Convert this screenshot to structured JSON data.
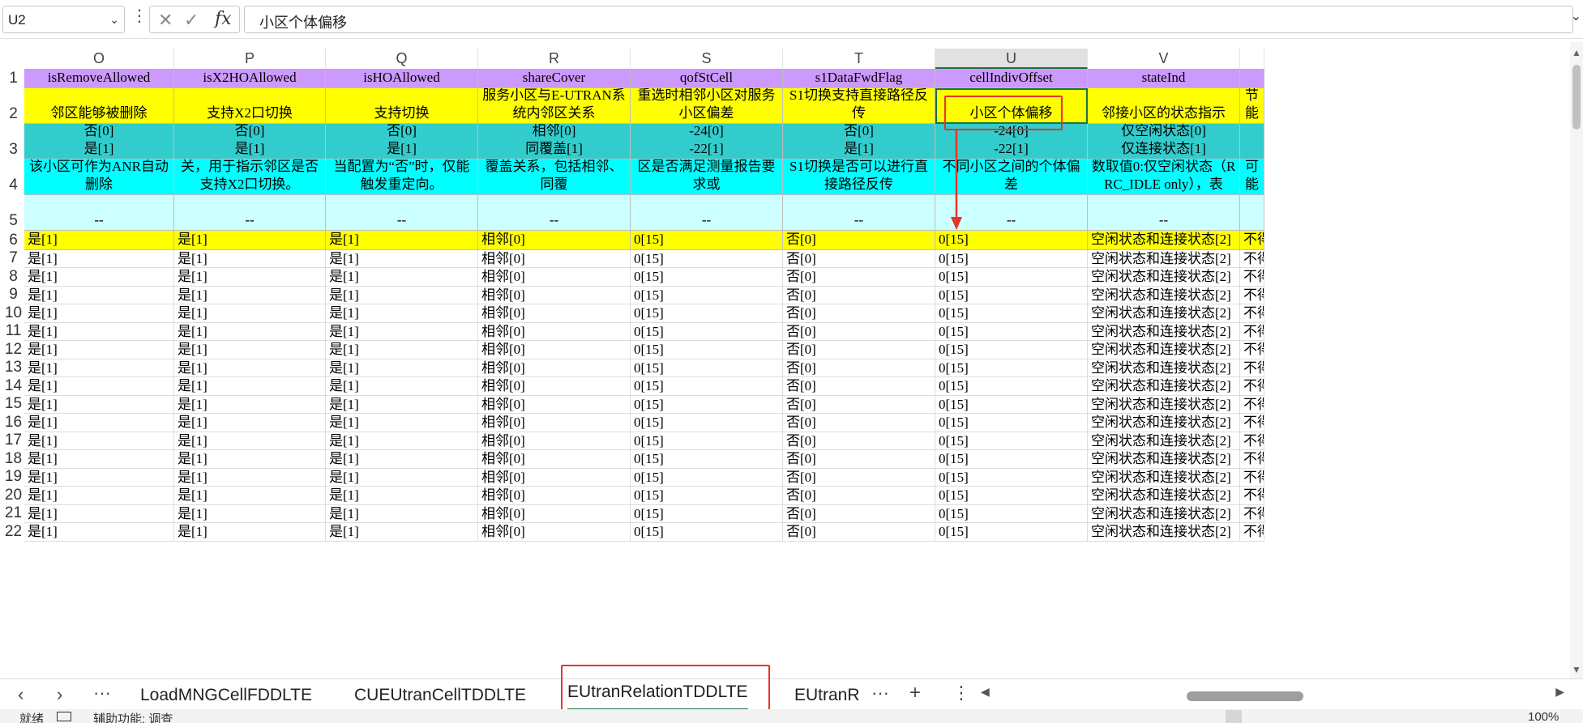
{
  "formula_bar": {
    "name_box": "U2",
    "formula": "小区个体偏移"
  },
  "columns": [
    "O",
    "P",
    "Q",
    "R",
    "S",
    "T",
    "U",
    "V"
  ],
  "selected_column": "U",
  "row_numbers": [
    "1",
    "2",
    "3",
    "4",
    "5",
    "6",
    "7",
    "8",
    "9",
    "10",
    "11",
    "12",
    "13",
    "14",
    "15",
    "16",
    "17",
    "18",
    "19",
    "20",
    "21",
    "22"
  ],
  "header_rows": {
    "r1": [
      "isRemoveAllowed",
      "isX2HOAllowed",
      "isHOAllowed",
      "shareCover",
      "qofStCell",
      "s1DataFwdFlag",
      "cellIndivOffset",
      "stateInd"
    ],
    "r2": [
      "邻区能够被删除",
      "支持X2口切换",
      "支持切换",
      "服务小区与E-UTRAN系统内邻区关系",
      "重选时相邻小区对服务小区偏差",
      "S1切换支持直接路径反传",
      "小区个体偏移",
      "邻接小区的状态指示",
      "节能"
    ],
    "r3a": [
      "否[0]",
      "否[0]",
      "否[0]",
      "相邻[0]",
      "-24[0]",
      "否[0]",
      "-24[0]",
      "仅空闲状态[0]"
    ],
    "r3b": [
      "是[1]",
      "是[1]",
      "是[1]",
      "同覆盖[1]",
      "-22[1]",
      "是[1]",
      "-22[1]",
      "仅连接状态[1]"
    ],
    "r4": [
      "关，参数取值为“是”，该小区可作为ANR自动删除",
      "关，用于指示邻区是否支持X2口切换。",
      "当配置为“否”时，仅能触发重定向。",
      "EUTRAN系统内邻区的覆盖关系，包括相邻、同覆",
      "区偏差。在衡量一个小区是否满足测量报告要求或",
      "S1切换是否可以进行直接路径反传",
      "不同小区之间的个体偏差",
      "数取值0:仅空闲状态（RRC_IDLE only），表",
      "被i可能"
    ],
    "r5": [
      "--",
      "--",
      "--",
      "--",
      "--",
      "--",
      "--",
      "--"
    ]
  },
  "data_row": [
    "是[1]",
    "是[1]",
    "是[1]",
    "相邻[0]",
    "0[15]",
    "否[0]",
    "0[15]",
    "空闲状态和连接状态[2]",
    "不得"
  ],
  "sheet_tabs": {
    "tabs": [
      "LoadMNGCellFDDLTE",
      "CUEUtranCellTDDLTE",
      "EUtranRelationTDDLTE",
      "EUtranR"
    ],
    "active": "EUtranRelationTDDLTE",
    "more": "···",
    "add": "+",
    "menu": "⋮"
  },
  "status_bar": {
    "left": "就绪",
    "accessibility": "辅助功能: 调查",
    "zoom": "100%"
  },
  "colors": {
    "header_purple": "#cc99ff",
    "desc_yellow": "#ffff00",
    "values_teal": "#33cccc",
    "notes_cyan": "#00ffff",
    "units_lightcyan": "#ccffff",
    "annotation_red": "#e8342b",
    "excel_green": "#1e7145"
  },
  "icons": [
    "chevron-down-icon",
    "cancel-x-icon",
    "check-icon",
    "fx-icon",
    "tab-prev-icon",
    "tab-next-icon",
    "add-sheet-icon",
    "red-arrow-icon"
  ]
}
